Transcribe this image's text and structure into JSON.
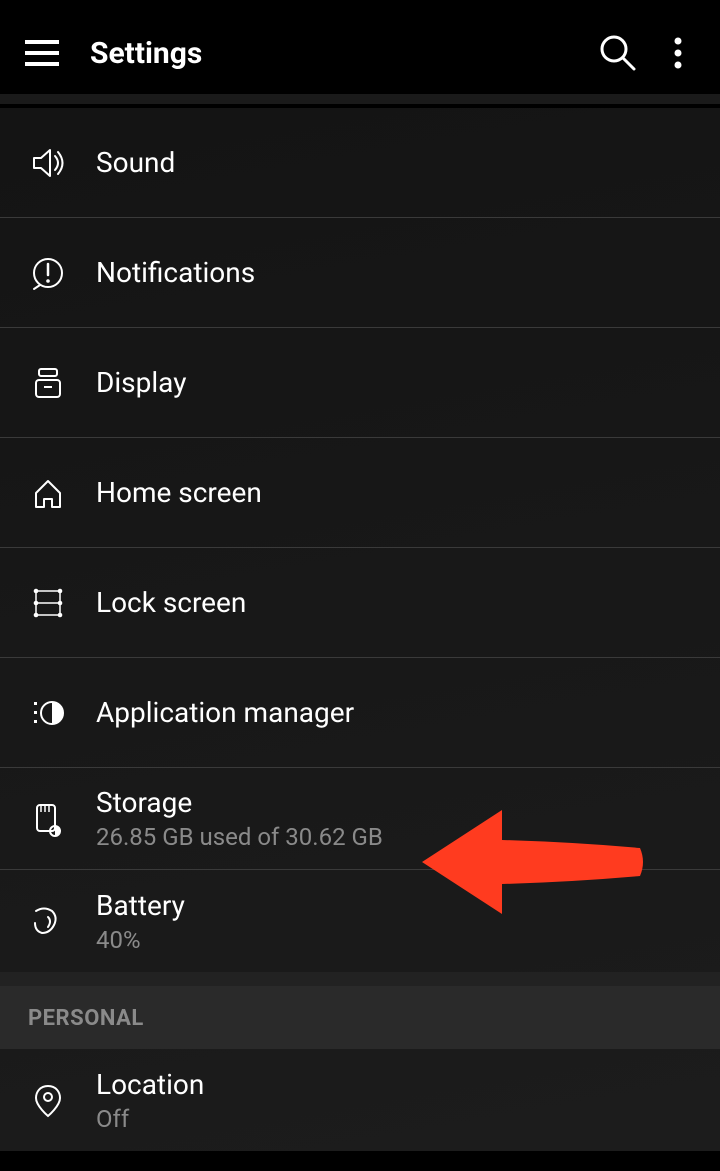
{
  "header": {
    "title": "Settings"
  },
  "items": {
    "sound": {
      "label": "Sound"
    },
    "notifications": {
      "label": "Notifications"
    },
    "display": {
      "label": "Display"
    },
    "home_screen": {
      "label": "Home screen"
    },
    "lock_screen": {
      "label": "Lock screen"
    },
    "application_manager": {
      "label": "Application manager"
    },
    "storage": {
      "label": "Storage",
      "sub": "26.85 GB used of 30.62 GB"
    },
    "battery": {
      "label": "Battery",
      "sub": "40%"
    },
    "location": {
      "label": "Location",
      "sub": "Off"
    }
  },
  "sections": {
    "personal": "PERSONAL"
  }
}
